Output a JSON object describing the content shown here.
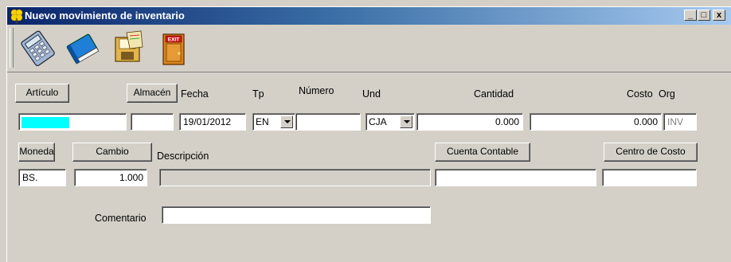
{
  "window": {
    "title": "Nuevo movimiento de inventario",
    "controls": {
      "minimize": "_",
      "maximize": "□",
      "close": "x"
    }
  },
  "toolbar": {
    "items": [
      {
        "name": "calculator",
        "icon": "calculator-icon"
      },
      {
        "name": "book",
        "icon": "book-icon"
      },
      {
        "name": "save",
        "icon": "save-icon"
      },
      {
        "name": "exit",
        "icon": "exit-door-icon",
        "sign": "EXIT"
      }
    ]
  },
  "form": {
    "articulo_button": "Artículo",
    "almacen_button": "Almacén",
    "fecha_label": "Fecha",
    "tp_label": "Tp",
    "numero_label": "Número",
    "und_label": "Und",
    "cantidad_label": "Cantidad",
    "costo_label": "Costo",
    "org_label": "Org",
    "articulo_value": "",
    "almacen_value": "",
    "fecha_value": "19/01/2012",
    "tp_value": "EN",
    "numero_value": "",
    "und_value": "CJA",
    "cantidad_value": "0.000",
    "costo_value": "0.000",
    "org_value": "INV",
    "moneda_button": "Moneda",
    "cambio_button": "Cambio",
    "descripcion_label": "Descripción",
    "cuenta_button": "Cuenta Contable",
    "centro_button": "Centro de Costo",
    "moneda_value": "BS.",
    "cambio_value": "1.000",
    "descripcion_value": "",
    "cuenta_value": "",
    "centro_value": "",
    "comentario_label": "Comentario",
    "comentario_value": ""
  },
  "colors": {
    "face": "#d4d0c8",
    "title_start": "#0a246a",
    "title_end": "#a6caf0",
    "articulo_highlight": "#00ffff"
  }
}
